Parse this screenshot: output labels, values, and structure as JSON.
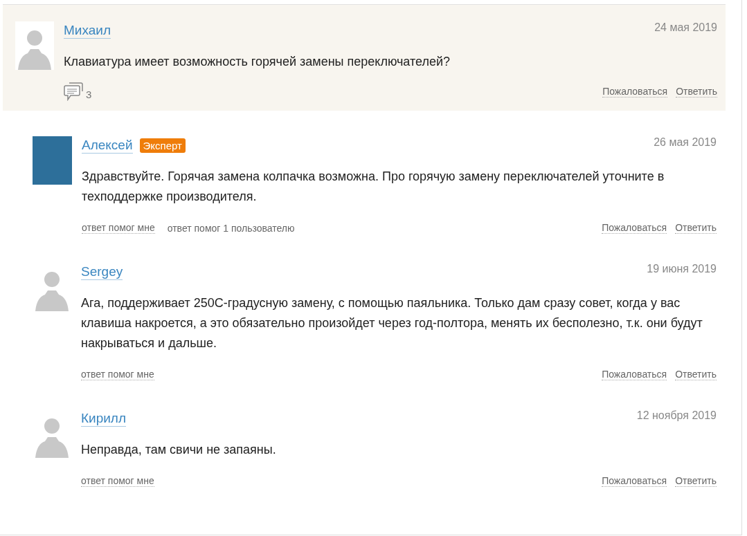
{
  "question": {
    "author": "Михаил",
    "date": "24 мая 2019",
    "text": "Клавиатура имеет возможность горячей замены переключателей?",
    "comments_count": "3",
    "actions": [
      "Пожаловаться",
      "Ответить"
    ]
  },
  "answers": [
    {
      "author": "Алексей",
      "custom_avatar": true,
      "badge": "Эксперт",
      "date": "26 мая 2019",
      "text": "Здравствуйте. Горячая замена колпачка возможна. Про горячую замену переключателей уточните в техподдержке производителя.",
      "helpful": [
        {
          "label": "ответ помог мне",
          "kind": "link"
        },
        {
          "label": "ответ помог 1 пользователю",
          "kind": "count"
        }
      ],
      "actions": [
        "Пожаловаться",
        "Ответить"
      ]
    },
    {
      "author": "Sergey",
      "custom_avatar": false,
      "date": "19 июня 2019",
      "text": "Ага, поддерживает 250С-градусную замену, с помощью паяльника. Только дам сразу совет, когда у вас клавиша накроется, а это обязательно произойдет через год-полтора, менять их бесполезно, т.к. они будут накрываться и дальше.",
      "helpful": [
        {
          "label": "ответ помог мне",
          "kind": "link"
        }
      ],
      "actions": [
        "Пожаловаться",
        "Ответить"
      ]
    },
    {
      "author": "Кирилл",
      "custom_avatar": false,
      "date": "12 ноября 2019",
      "text": "Неправда, там свичи не запаяны.",
      "helpful": [
        {
          "label": "ответ помог мне",
          "kind": "link"
        }
      ],
      "actions": [
        "Пожаловаться",
        "Ответить"
      ]
    }
  ]
}
